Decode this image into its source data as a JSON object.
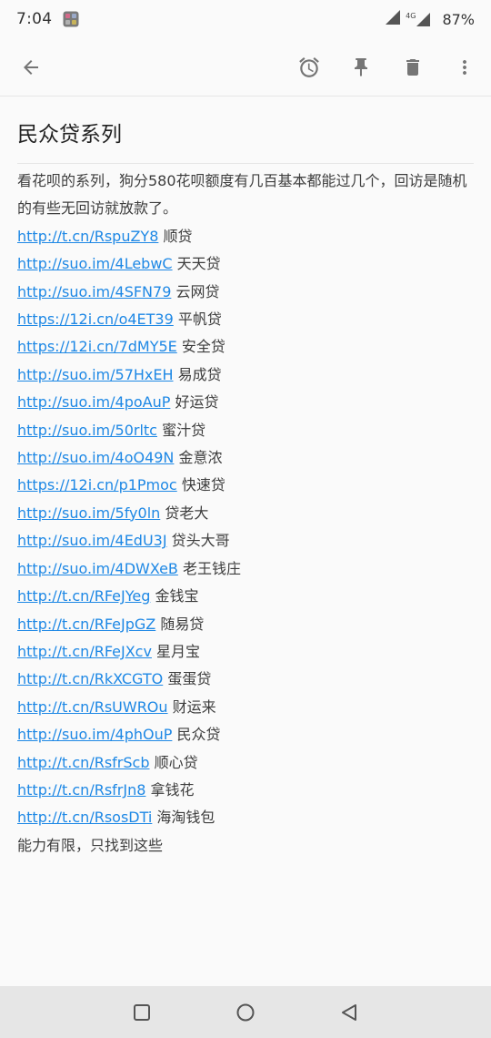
{
  "status_bar": {
    "time": "7:04",
    "network": "4G",
    "battery": "87%"
  },
  "toolbar": {
    "icons": [
      "back-arrow-icon",
      "alarm-icon",
      "pin-icon",
      "trash-icon",
      "more-vert-icon"
    ]
  },
  "note": {
    "title": "民众贷系列",
    "intro": "看花呗的系列，狗分580花呗额度有几百基本都能过几个，回访是随机的有些无回访就放款了。",
    "entries": [
      {
        "url": "http://t.cn/RspuZY8",
        "name": "顺贷"
      },
      {
        "url": "http://suo.im/4LebwC",
        "name": "天天贷"
      },
      {
        "url": "http://suo.im/4SFN79",
        "name": "云网贷"
      },
      {
        "url": "https://12i.cn/o4ET39",
        "name": "平帆贷"
      },
      {
        "url": "https://12i.cn/7dMY5E",
        "name": "安全贷"
      },
      {
        "url": "http://suo.im/57HxEH",
        "name": "易成贷"
      },
      {
        "url": "http://suo.im/4poAuP",
        "name": "好运贷"
      },
      {
        "url": "http://suo.im/50rltc",
        "name": "蜜汁贷"
      },
      {
        "url": "http://suo.im/4oO49N",
        "name": "金意浓"
      },
      {
        "url": "https://12i.cn/p1Pmoc",
        "name": "快速贷"
      },
      {
        "url": "http://suo.im/5fy0ln",
        "name": "贷老大"
      },
      {
        "url": "http://suo.im/4EdU3J",
        "name": "贷头大哥"
      },
      {
        "url": "http://suo.im/4DWXeB",
        "name": "老王钱庄"
      },
      {
        "url": "http://t.cn/RFeJYeg",
        "name": "金钱宝"
      },
      {
        "url": "http://t.cn/RFeJpGZ",
        "name": "随易贷"
      },
      {
        "url": "http://t.cn/RFeJXcv",
        "name": "星月宝"
      },
      {
        "url": "http://t.cn/RkXCGTO",
        "name": "蛋蛋贷"
      },
      {
        "url": "http://t.cn/RsUWROu",
        "name": "财运来"
      },
      {
        "url": "http://suo.im/4phOuP",
        "name": "民众贷"
      },
      {
        "url": "http://t.cn/RsfrScb",
        "name": "顺心贷"
      },
      {
        "url": "http://t.cn/RsfrJn8",
        "name": "拿钱花"
      },
      {
        "url": "http://t.cn/RsosDTi",
        "name": "海淘钱包"
      }
    ],
    "footer": "能力有限，只找到这些"
  },
  "nav_bar": {
    "icons": [
      "recents-square-icon",
      "home-circle-icon",
      "back-triangle-icon"
    ]
  },
  "colors": {
    "link": "#1e88e5",
    "icon": "#757575",
    "background": "#fafafa",
    "nav_bar": "#e6e6e6"
  }
}
